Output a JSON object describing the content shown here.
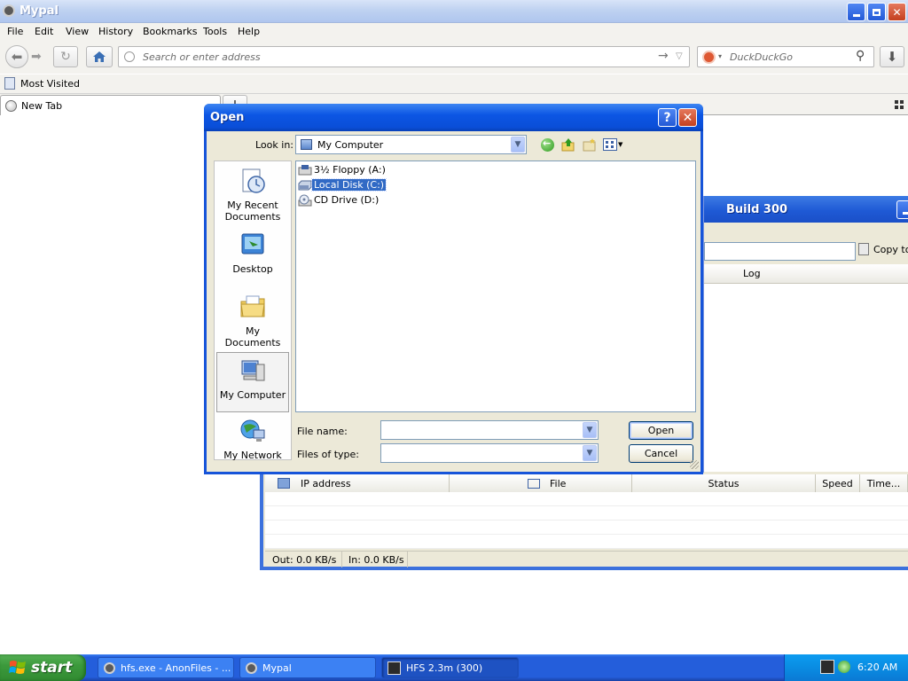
{
  "browser": {
    "title": "Mypal",
    "menu": [
      "File",
      "Edit",
      "View",
      "History",
      "Bookmarks",
      "Tools",
      "Help"
    ],
    "address_placeholder": "Search or enter address",
    "search_engine": "DuckDuckGo",
    "bookmarks_toolbar": {
      "most_visited": "Most Visited"
    },
    "tab": {
      "label": "New Tab"
    }
  },
  "hfs": {
    "title_fragment": "Build 300",
    "copy_button": "Copy to",
    "log_header": "Log",
    "columns": [
      "IP address",
      "File",
      "Status",
      "Speed",
      "Time..."
    ],
    "status_out": "Out: 0.0 KB/s",
    "status_in": "In: 0.0 KB/s"
  },
  "dialog": {
    "title": "Open",
    "look_in_label": "Look in:",
    "look_in_value": "My Computer",
    "places": [
      "My Recent Documents",
      "Desktop",
      "My Documents",
      "My Computer",
      "My Network"
    ],
    "files": [
      {
        "name": "3½ Floppy (A:)",
        "selected": false
      },
      {
        "name": "Local Disk (C:)",
        "selected": true
      },
      {
        "name": "CD Drive (D:)",
        "selected": false
      }
    ],
    "file_name_label": "File name:",
    "file_name_value": "",
    "files_of_type_label": "Files of type:",
    "files_of_type_value": "",
    "open_button": "Open",
    "cancel_button": "Cancel"
  },
  "taskbar": {
    "start_label": "start",
    "tasks": [
      {
        "label": "hfs.exe - AnonFiles - ..."
      },
      {
        "label": "Mypal"
      },
      {
        "label": "HFS 2.3m (300)"
      }
    ],
    "clock": "6:20 AM"
  },
  "colors": {
    "xp_blue": "#245edb",
    "selection": "#316ac5",
    "start_green": "#3c9a3c",
    "dialog_face": "#ece9d8"
  }
}
